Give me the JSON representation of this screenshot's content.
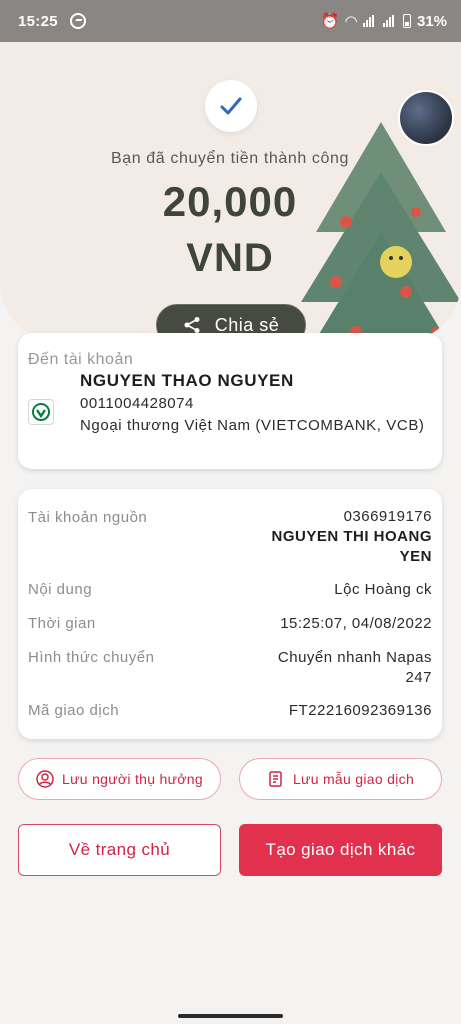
{
  "status_bar": {
    "time": "15:25",
    "battery": "31%"
  },
  "hero": {
    "message": "Bạn đã chuyển tiền thành công",
    "amount": "20,000",
    "currency": "VND",
    "share_label": "Chia sẻ"
  },
  "recipient": {
    "label": "Đến tài khoản",
    "name": "NGUYEN THAO NGUYEN",
    "account": "0011004428074",
    "bank": "Ngoại thương Việt Nam (VIETCOMBANK, VCB)"
  },
  "details": {
    "source_label": "Tài khoản nguồn",
    "source_account": "0366919176",
    "source_name_line1": "NGUYEN THI HOANG",
    "source_name_line2": "YEN",
    "content_label": "Nội dung",
    "content_value": "Lộc Hoàng ck",
    "time_label": "Thời gian",
    "time_value": "15:25:07, 04/08/2022",
    "method_label": "Hình thức chuyển",
    "method_line1": "Chuyển nhanh Napas",
    "method_line2": "247",
    "txn_label": "Mã giao dịch",
    "txn_value": "FT22216092369136"
  },
  "actions": {
    "save_beneficiary": "Lưu người thụ hưởng",
    "save_template": "Lưu mẫu giao dịch",
    "home": "Về trang chủ",
    "new_transaction": "Tạo giao dịch khác"
  },
  "colors": {
    "accent": "#e2304f",
    "share_bg": "#474b3f",
    "amount_text": "#3e4539"
  }
}
